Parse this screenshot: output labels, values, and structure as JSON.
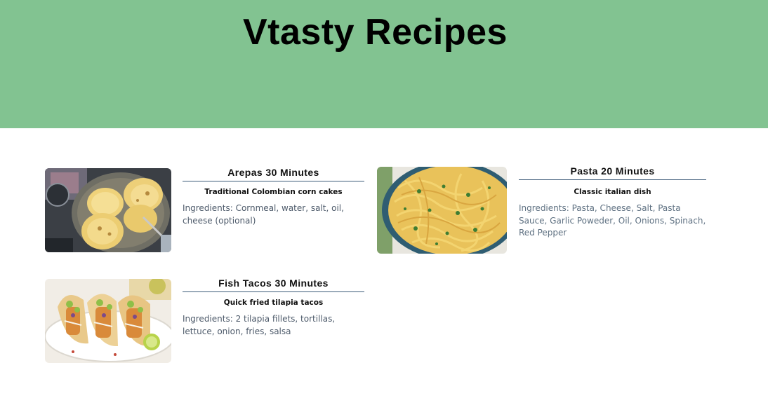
{
  "header": {
    "title": "Vtasty Recipes",
    "background": "#82c391"
  },
  "recipes": [
    {
      "title": "Arepas 30 Minutes",
      "subtitle": "Traditional Colombian corn cakes",
      "ingredients": "Ingredients: Cornmeal, water, salt, oil, cheese (optional)",
      "image_icon": "arepas-photo"
    },
    {
      "title": "Pasta 20 Minutes",
      "subtitle": "Classic italian dish",
      "ingredients": "Ingredients: Pasta, Cheese, Salt, Pasta Sauce, Garlic Poweder, Oil, Onions, Spinach, Red Pepper",
      "image_icon": "pasta-photo"
    },
    {
      "title": "Fish Tacos 30 Minutes",
      "subtitle": "Quick fried tilapia tacos",
      "ingredients": "Ingredients: 2 tilapia fillets, tortillas, lettuce, onion, fries, salsa",
      "image_icon": "fish-tacos-photo"
    }
  ]
}
